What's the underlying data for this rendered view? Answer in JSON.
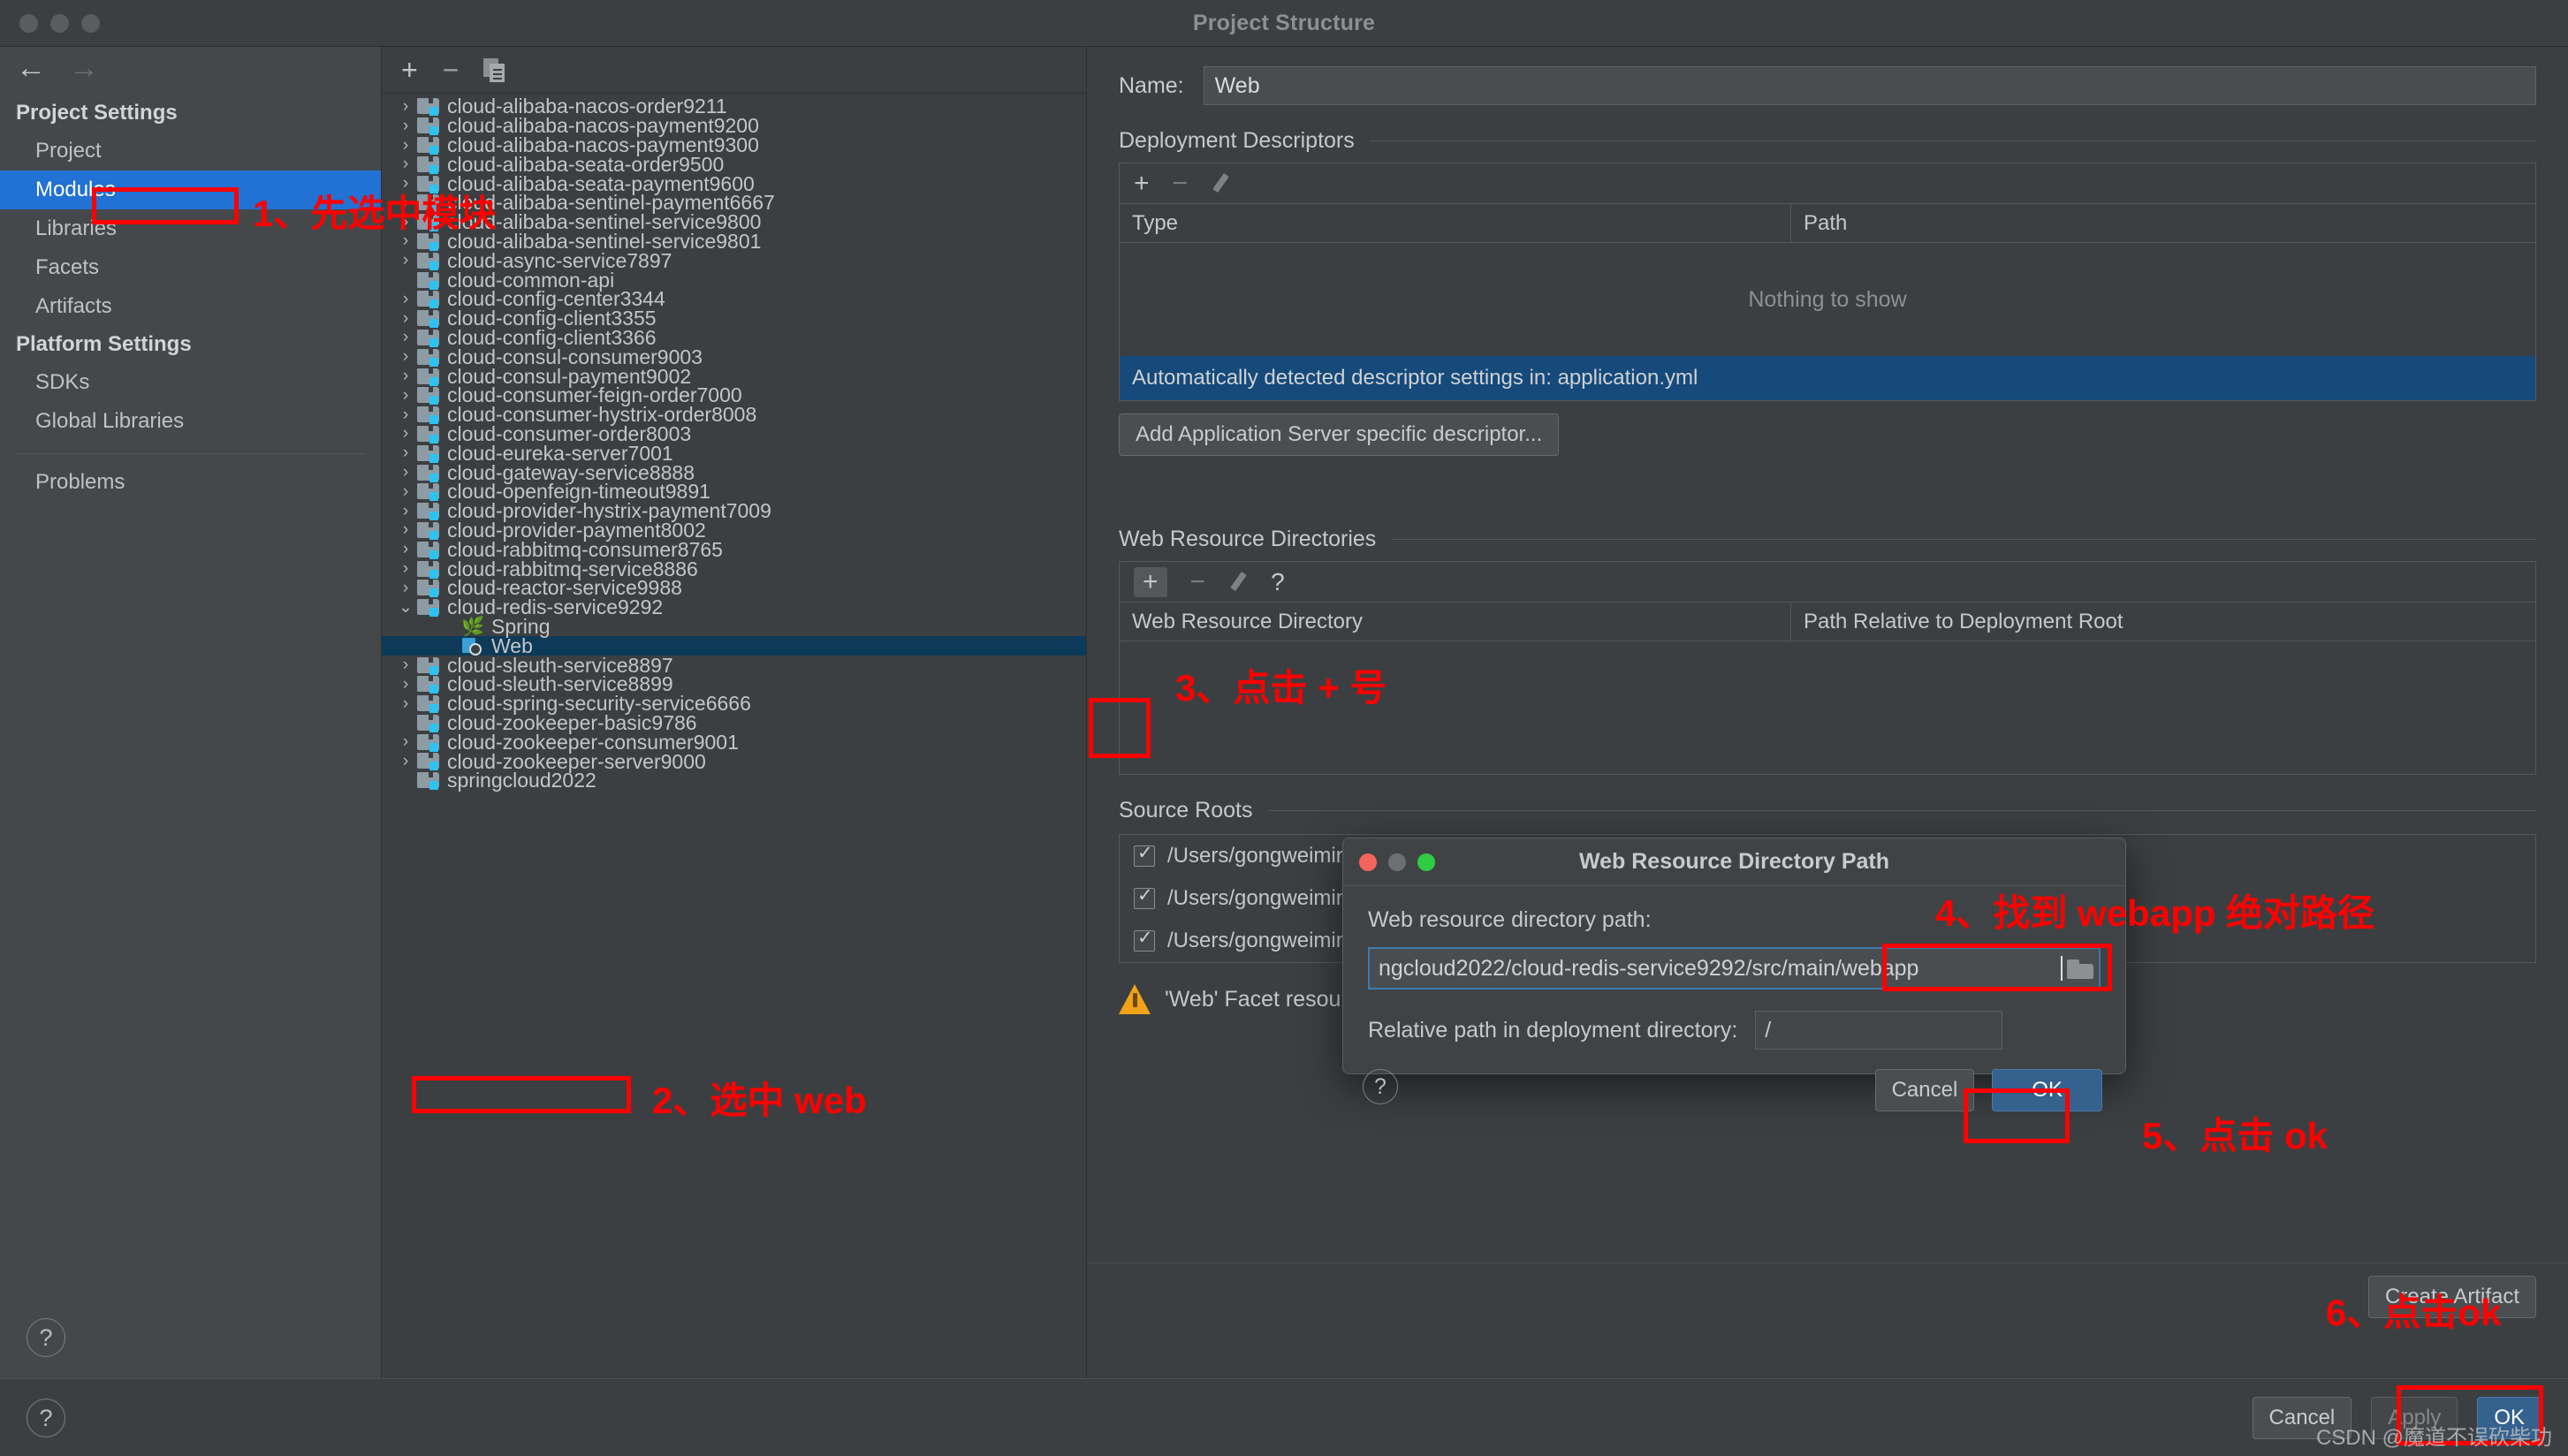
{
  "window": {
    "title": "Project Structure"
  },
  "left_nav": {
    "back_icon": "←",
    "forward_icon": "→",
    "groups": [
      {
        "title": "Project Settings",
        "items": [
          {
            "label": "Project",
            "selected": false
          },
          {
            "label": "Modules",
            "selected": true
          },
          {
            "label": "Libraries",
            "selected": false
          },
          {
            "label": "Facets",
            "selected": false
          },
          {
            "label": "Artifacts",
            "selected": false
          }
        ]
      },
      {
        "title": "Platform Settings",
        "items": [
          {
            "label": "SDKs",
            "selected": false
          },
          {
            "label": "Global Libraries",
            "selected": false
          }
        ]
      }
    ],
    "problems_label": "Problems",
    "help_icon": "?"
  },
  "tree_toolbar": {
    "add_icon": "+",
    "remove_icon": "−",
    "copy_icon": "copy-icon"
  },
  "module_tree": [
    {
      "label": "cloud-alibaba-nacos-order9211",
      "expandable": true,
      "expanded": false,
      "level": 1,
      "icon": "module-icon"
    },
    {
      "label": "cloud-alibaba-nacos-payment9200",
      "expandable": true,
      "expanded": false,
      "level": 1,
      "icon": "module-icon"
    },
    {
      "label": "cloud-alibaba-nacos-payment9300",
      "expandable": true,
      "expanded": false,
      "level": 1,
      "icon": "module-icon"
    },
    {
      "label": "cloud-alibaba-seata-order9500",
      "expandable": true,
      "expanded": false,
      "level": 1,
      "icon": "module-icon"
    },
    {
      "label": "cloud-alibaba-seata-payment9600",
      "expandable": true,
      "expanded": false,
      "level": 1,
      "icon": "module-icon"
    },
    {
      "label": "cloud-alibaba-sentinel-payment6667",
      "expandable": true,
      "expanded": false,
      "level": 1,
      "icon": "module-icon"
    },
    {
      "label": "cloud-alibaba-sentinel-service9800",
      "expandable": true,
      "expanded": false,
      "level": 1,
      "icon": "module-icon"
    },
    {
      "label": "cloud-alibaba-sentinel-service9801",
      "expandable": true,
      "expanded": false,
      "level": 1,
      "icon": "module-icon"
    },
    {
      "label": "cloud-async-service7897",
      "expandable": true,
      "expanded": false,
      "level": 1,
      "icon": "module-icon"
    },
    {
      "label": "cloud-common-api",
      "expandable": false,
      "expanded": false,
      "level": 1,
      "icon": "module-icon"
    },
    {
      "label": "cloud-config-center3344",
      "expandable": true,
      "expanded": false,
      "level": 1,
      "icon": "module-icon"
    },
    {
      "label": "cloud-config-client3355",
      "expandable": true,
      "expanded": false,
      "level": 1,
      "icon": "module-icon"
    },
    {
      "label": "cloud-config-client3366",
      "expandable": true,
      "expanded": false,
      "level": 1,
      "icon": "module-icon"
    },
    {
      "label": "cloud-consul-consumer9003",
      "expandable": true,
      "expanded": false,
      "level": 1,
      "icon": "module-icon"
    },
    {
      "label": "cloud-consul-payment9002",
      "expandable": true,
      "expanded": false,
      "level": 1,
      "icon": "module-icon"
    },
    {
      "label": "cloud-consumer-feign-order7000",
      "expandable": true,
      "expanded": false,
      "level": 1,
      "icon": "module-icon"
    },
    {
      "label": "cloud-consumer-hystrix-order8008",
      "expandable": true,
      "expanded": false,
      "level": 1,
      "icon": "module-icon"
    },
    {
      "label": "cloud-consumer-order8003",
      "expandable": true,
      "expanded": false,
      "level": 1,
      "icon": "module-icon"
    },
    {
      "label": "cloud-eureka-server7001",
      "expandable": true,
      "expanded": false,
      "level": 1,
      "icon": "module-icon"
    },
    {
      "label": "cloud-gateway-service8888",
      "expandable": true,
      "expanded": false,
      "level": 1,
      "icon": "module-icon"
    },
    {
      "label": "cloud-openfeign-timeout9891",
      "expandable": true,
      "expanded": false,
      "level": 1,
      "icon": "module-icon"
    },
    {
      "label": "cloud-provider-hystrix-payment7009",
      "expandable": true,
      "expanded": false,
      "level": 1,
      "icon": "module-icon"
    },
    {
      "label": "cloud-provider-payment8002",
      "expandable": true,
      "expanded": false,
      "level": 1,
      "icon": "module-icon"
    },
    {
      "label": "cloud-rabbitmq-consumer8765",
      "expandable": true,
      "expanded": false,
      "level": 1,
      "icon": "module-icon"
    },
    {
      "label": "cloud-rabbitmq-service8886",
      "expandable": true,
      "expanded": false,
      "level": 1,
      "icon": "module-icon"
    },
    {
      "label": "cloud-reactor-service9988",
      "expandable": true,
      "expanded": false,
      "level": 1,
      "icon": "module-icon"
    },
    {
      "label": "cloud-redis-service9292",
      "expandable": true,
      "expanded": true,
      "level": 1,
      "icon": "module-icon"
    },
    {
      "label": "Spring",
      "expandable": false,
      "expanded": false,
      "level": 2,
      "icon": "spring-leaf-icon"
    },
    {
      "label": "Web",
      "expandable": false,
      "expanded": false,
      "level": 2,
      "icon": "web-facet-icon",
      "selected": true
    },
    {
      "label": "cloud-sleuth-service8897",
      "expandable": true,
      "expanded": false,
      "level": 1,
      "icon": "module-icon"
    },
    {
      "label": "cloud-sleuth-service8899",
      "expandable": true,
      "expanded": false,
      "level": 1,
      "icon": "module-icon"
    },
    {
      "label": "cloud-spring-security-service6666",
      "expandable": true,
      "expanded": false,
      "level": 1,
      "icon": "module-icon"
    },
    {
      "label": "cloud-zookeeper-basic9786",
      "expandable": false,
      "expanded": false,
      "level": 1,
      "icon": "module-icon"
    },
    {
      "label": "cloud-zookeeper-consumer9001",
      "expandable": true,
      "expanded": false,
      "level": 1,
      "icon": "module-icon"
    },
    {
      "label": "cloud-zookeeper-server9000",
      "expandable": true,
      "expanded": false,
      "level": 1,
      "icon": "module-icon"
    },
    {
      "label": "springcloud2022",
      "expandable": false,
      "expanded": false,
      "level": 1,
      "icon": "module-icon"
    }
  ],
  "facet": {
    "name_label": "Name:",
    "name_value": "Web",
    "deployment_descriptors": {
      "section_title": "Deployment Descriptors",
      "toolbar": {
        "add": "+",
        "remove": "−",
        "edit": "edit-pencil-icon"
      },
      "columns": [
        "Type",
        "Path"
      ],
      "empty_text": "Nothing to show",
      "info_strip": "Automatically detected descriptor settings in: application.yml",
      "add_button": "Add Application Server specific descriptor..."
    },
    "web_resource_directories": {
      "section_title": "Web Resource Directories",
      "toolbar": {
        "add": "+",
        "remove": "−",
        "edit": "edit-pencil-icon",
        "help": "?"
      },
      "columns": [
        "Web Resource Directory",
        "Path Relative to Deployment Root"
      ]
    },
    "source_roots": {
      "section_title": "Source Roots",
      "rows": [
        {
          "checked": true,
          "path": "/Users/gongweiming/IdeaProjects/springcloud2022/cloud-redis-service9292/src/main/resources"
        },
        {
          "checked": true,
          "path": "/Users/gongweiming/IdeaProjects/springcloud2022/cloud-redis-service9292/src/main/java"
        },
        {
          "checked": true,
          "path": "/Users/gongweiming/IdeaProjects/springcloud2022/cloud-redis-service9292/src/main/abc"
        }
      ]
    },
    "warning": {
      "icon": "warning-triangle-icon",
      "text": "'Web' Facet resources are not included in any artifacts"
    },
    "create_artifact_button": "Create Artifact"
  },
  "footer": {
    "help_icon": "?",
    "cancel": "Cancel",
    "apply": "Apply",
    "ok": "OK"
  },
  "modal": {
    "title": "Web Resource Directory Path",
    "traffic": {
      "close": "close-dot",
      "minimize": "minimize-dot",
      "zoom": "zoom-dot"
    },
    "path_label": "Web resource directory path:",
    "path_value": "ngcloud2022/cloud-redis-service9292/src/main/webapp",
    "browse_icon": "folder-icon",
    "relative_label": "Relative path in deployment directory:",
    "relative_value": "/",
    "help_icon": "?",
    "cancel": "Cancel",
    "ok": "OK"
  },
  "annotations": {
    "color": "#ff0000",
    "steps": [
      {
        "id": "step1",
        "text": "1、先选中模块"
      },
      {
        "id": "step2",
        "text": "2、选中 web"
      },
      {
        "id": "step3",
        "text": "3、点击 + 号"
      },
      {
        "id": "step4",
        "text": "4、找到 webapp 绝对路径"
      },
      {
        "id": "step5",
        "text": "5、点击 ok"
      },
      {
        "id": "step6",
        "text": "6、点击ok"
      }
    ]
  },
  "watermark": "CSDN @魔道不误砍柴功"
}
